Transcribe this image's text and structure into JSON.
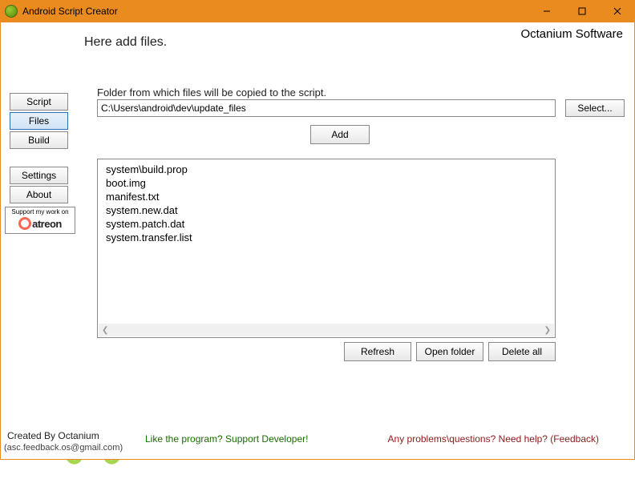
{
  "window": {
    "title": "Android Script Creator",
    "company": "Octanium Software"
  },
  "heading": "Here add files.",
  "sidebar": {
    "script": "Script",
    "files": "Files",
    "build": "Build",
    "settings": "Settings",
    "about": "About"
  },
  "patreon": {
    "top": "Support my work on",
    "word": "atreon"
  },
  "folder": {
    "label": "Folder from which files will be copied to the script.",
    "path": "C:\\Users\\android\\dev\\update_files",
    "select": "Select...",
    "add": "Add"
  },
  "files": [
    "system\\build.prop",
    "boot.img",
    "manifest.txt",
    "system.new.dat",
    "system.patch.dat",
    "system.transfer.list"
  ],
  "buttons": {
    "refresh": "Refresh",
    "openfolder": "Open folder",
    "deleteall": "Delete all"
  },
  "footer": {
    "createdby": "Created By Octanium",
    "email": "(asc.feedback.os@gmail.com)",
    "like": "Like the program? Support Developer!",
    "feedback": "Any problems\\questions? Need help? (Feedback)"
  }
}
